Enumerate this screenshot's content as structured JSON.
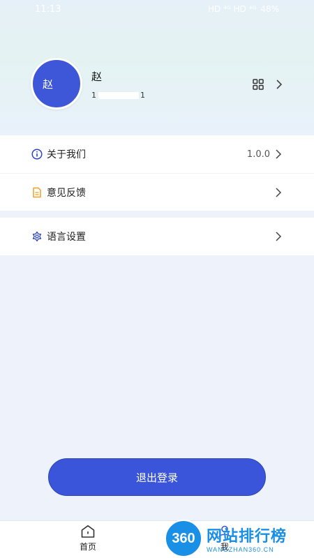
{
  "status_bar": {
    "time": "11:13",
    "battery": "48%",
    "signal": "HD ⁴ᴳ HD ⁴ᴳ"
  },
  "profile": {
    "avatar_text": "赵",
    "name": "赵",
    "phone_prefix": "1",
    "phone_suffix": "1"
  },
  "menu": {
    "about": {
      "label": "关于我们",
      "value": "1.0.0"
    },
    "feedback": {
      "label": "意见反馈"
    },
    "language": {
      "label": "语言设置"
    }
  },
  "logout": {
    "label": "退出登录"
  },
  "bottom_nav": {
    "home": "首页",
    "me": "我"
  },
  "watermark": {
    "badge": "360",
    "title": "网站排行榜",
    "subtitle": "WANGZHAN360.CN"
  },
  "colors": {
    "accent": "#3a55d9",
    "feedback_icon": "#f0a020"
  }
}
